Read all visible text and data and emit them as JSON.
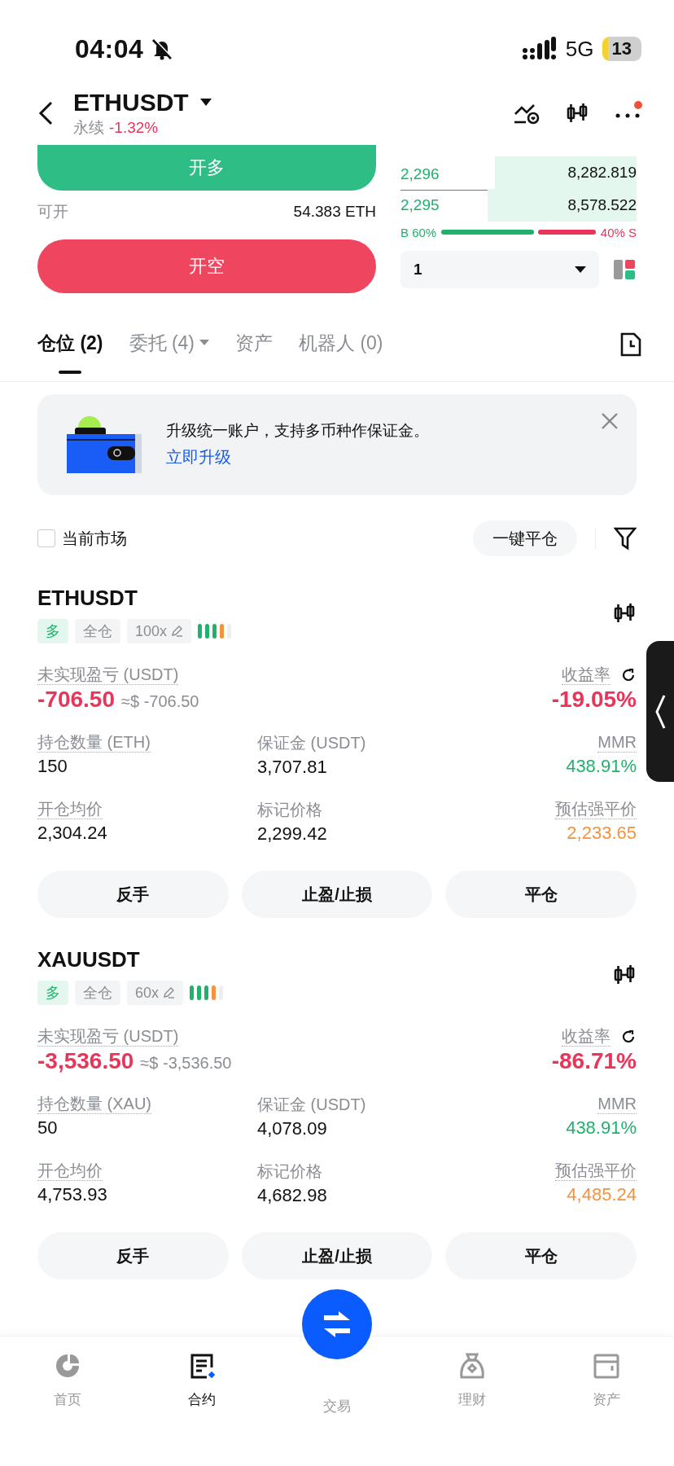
{
  "status_bar": {
    "time": "04:04",
    "network": "5G",
    "battery": "13"
  },
  "header": {
    "symbol": "ETHUSDT",
    "contract_type": "永续",
    "change": "-1.32%"
  },
  "trade": {
    "long_button": "开多",
    "available_label": "可开",
    "available_value": "54.383 ETH",
    "short_button": "开空"
  },
  "order_book": {
    "rows": [
      {
        "price": "2,296",
        "amount": "8,282.819"
      },
      {
        "price": "2,295",
        "amount": "8,578.522"
      }
    ],
    "ratio": {
      "buy_label": "B 60%",
      "sell_label": "40% S"
    },
    "depth_select": {
      "value": "1"
    }
  },
  "tabs": [
    {
      "label": "仓位 (2)",
      "selected": true,
      "dropdown": false
    },
    {
      "label": "委托 (4)",
      "selected": false,
      "dropdown": true
    },
    {
      "label": "资产",
      "selected": false,
      "dropdown": false
    },
    {
      "label": "机器人 (0)",
      "selected": false,
      "dropdown": false
    }
  ],
  "banner": {
    "text": "升级统一账户，支持多币种作保证金。",
    "link": "立即升级"
  },
  "filter": {
    "checkbox_label": "当前市场",
    "checked": false,
    "close_all_button": "一键平仓"
  },
  "positions": [
    {
      "symbol": "ETHUSDT",
      "side": "多",
      "margin_mode": "全仓",
      "leverage": "100x",
      "pnl_label": "未实现盈亏 (USDT)",
      "pnl": "-706.50",
      "pnl_usd": "≈$ -706.50",
      "roe_label": "收益率",
      "roe": "-19.05%",
      "fields": [
        {
          "label": "持仓数量 (ETH)",
          "value": "150",
          "color": "#111111",
          "underlined": true
        },
        {
          "label": "保证金 (USDT)",
          "value": "3,707.81",
          "color": "#111111",
          "underlined": false
        },
        {
          "label": "MMR",
          "value": "438.91%",
          "color": "#20b26c",
          "underlined": true
        },
        {
          "label": "开仓均价",
          "value": "2,304.24",
          "color": "#111111",
          "underlined": true
        },
        {
          "label": "标记价格",
          "value": "2,299.42",
          "color": "#111111",
          "underlined": false
        },
        {
          "label": "预估强平价",
          "value": "2,233.65",
          "color": "#f5923e",
          "underlined": true
        }
      ],
      "actions": [
        "反手",
        "止盈/止损",
        "平仓"
      ]
    },
    {
      "symbol": "XAUUSDT",
      "side": "多",
      "margin_mode": "全仓",
      "leverage": "60x",
      "pnl_label": "未实现盈亏 (USDT)",
      "pnl": "-3,536.50",
      "pnl_usd": "≈$ -3,536.50",
      "roe_label": "收益率",
      "roe": "-86.71%",
      "fields": [
        {
          "label": "持仓数量 (XAU)",
          "value": "50",
          "color": "#111111",
          "underlined": true
        },
        {
          "label": "保证金 (USDT)",
          "value": "4,078.09",
          "color": "#111111",
          "underlined": false
        },
        {
          "label": "MMR",
          "value": "438.91%",
          "color": "#20b26c",
          "underlined": true
        },
        {
          "label": "开仓均价",
          "value": "4,753.93",
          "color": "#111111",
          "underlined": true
        },
        {
          "label": "标记价格",
          "value": "4,682.98",
          "color": "#111111",
          "underlined": false
        },
        {
          "label": "预估强平价",
          "value": "4,485.24",
          "color": "#f5923e",
          "underlined": true
        }
      ],
      "actions": [
        "反手",
        "止盈/止损",
        "平仓"
      ]
    }
  ],
  "nav": [
    {
      "label": "首页",
      "kind": "home",
      "selected": false
    },
    {
      "label": "合约",
      "kind": "contract",
      "selected": true
    },
    {
      "label": "交易",
      "kind": "trade",
      "selected": false
    },
    {
      "label": "理财",
      "kind": "earn",
      "selected": false
    },
    {
      "label": "资产",
      "kind": "assets",
      "selected": false
    }
  ]
}
